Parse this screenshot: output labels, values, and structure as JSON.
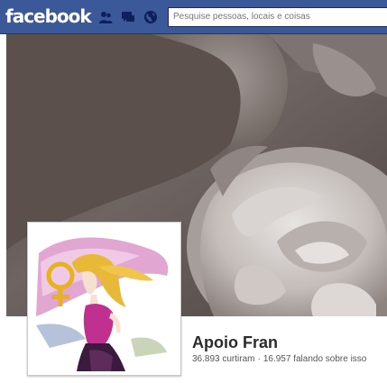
{
  "topbar": {
    "logo": "facebook",
    "search_placeholder": "Pesquise pessoas, locais e coisas",
    "brand_color": "#3b5998"
  },
  "icons": {
    "friend_requests": "friends-icon",
    "messages": "messages-icon",
    "notifications": "globe-icon"
  },
  "page": {
    "name": "Apoio Fran",
    "likes": "36.893 curtiram",
    "separator": "·",
    "talking": "16.957 falando sobre isso"
  }
}
